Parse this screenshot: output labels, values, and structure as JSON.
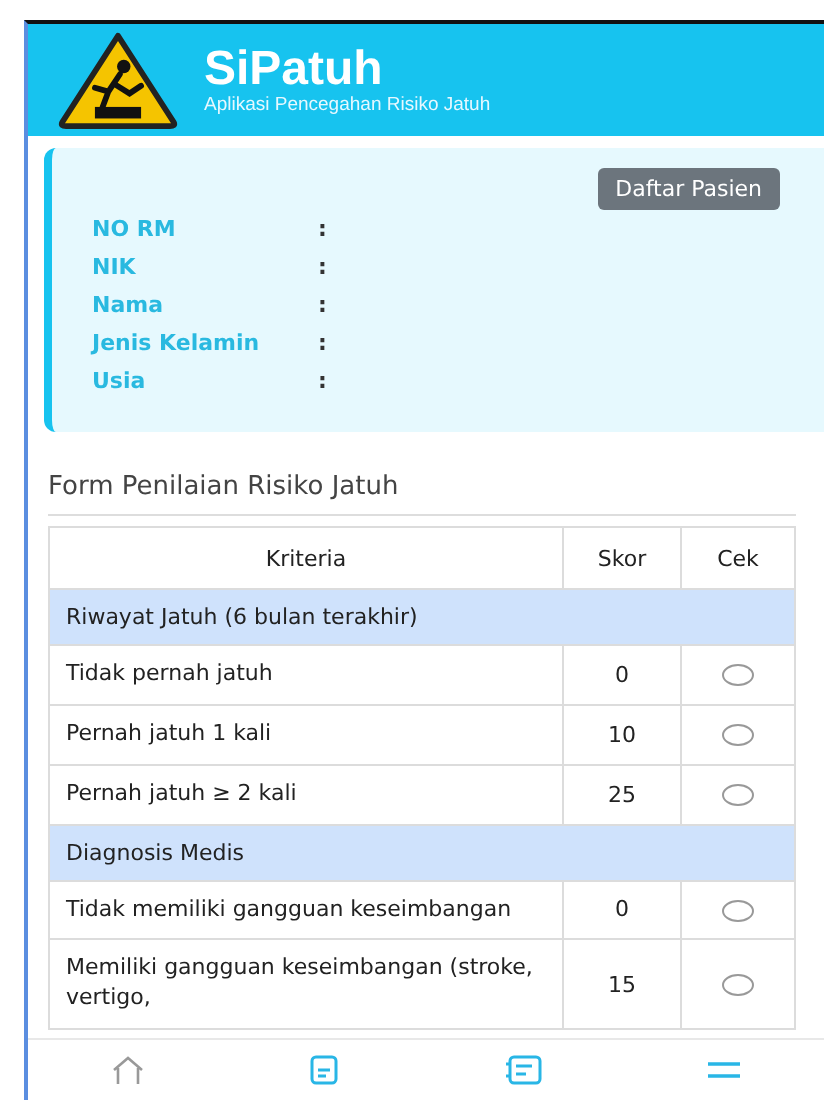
{
  "header": {
    "title": "SiPatuh",
    "subtitle": "Aplikasi Pencegahan Risiko Jatuh"
  },
  "patient": {
    "button": "Daftar Pasien",
    "fields": [
      {
        "label": "NO RM",
        "separator": ":"
      },
      {
        "label": "NIK",
        "separator": ":"
      },
      {
        "label": "Nama",
        "separator": ":"
      },
      {
        "label": "Jenis Kelamin",
        "separator": ":"
      },
      {
        "label": "Usia",
        "separator": ":"
      }
    ]
  },
  "form": {
    "title": "Form Penilaian Risiko Jatuh",
    "columns": [
      "Kriteria",
      "Skor",
      "Cek"
    ],
    "rows": [
      {
        "kind": "group",
        "label": "Riwayat Jatuh (6 bulan terakhir)"
      },
      {
        "kind": "item",
        "label": "Tidak pernah jatuh",
        "score": "0",
        "checked": false
      },
      {
        "kind": "item",
        "label": "Pernah jatuh 1 kali",
        "score": "10",
        "checked": false
      },
      {
        "kind": "item",
        "label": "Pernah jatuh ≥ 2 kali",
        "score": "25",
        "checked": false
      },
      {
        "kind": "group",
        "label": "Diagnosis Medis"
      },
      {
        "kind": "item",
        "label": "Tidak memiliki gangguan keseimbangan",
        "score": "0",
        "checked": false
      },
      {
        "kind": "item",
        "label": "Memiliki gangguan keseimbangan (stroke, vertigo,",
        "score": "15",
        "checked": false
      }
    ]
  },
  "nav": [
    {
      "kind": "home"
    },
    {
      "kind": "document"
    },
    {
      "kind": "list"
    },
    {
      "kind": "menu"
    }
  ]
}
